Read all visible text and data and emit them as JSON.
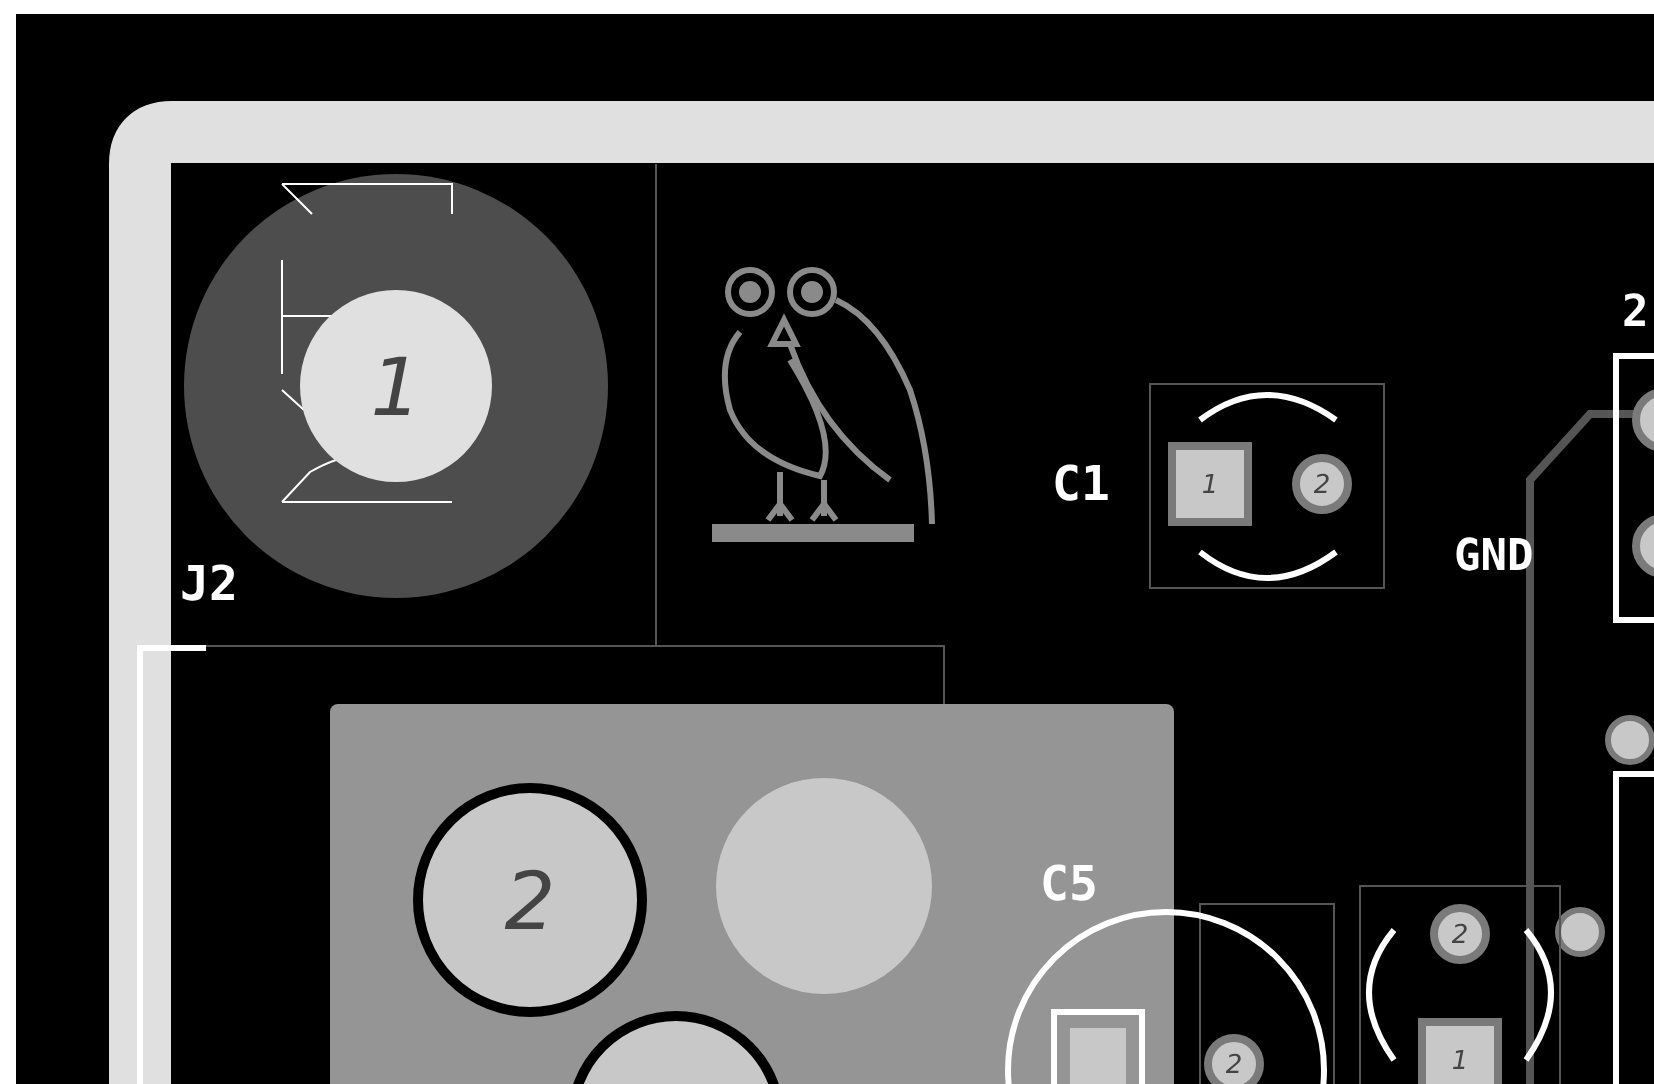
{
  "board": {
    "labels": [
      {
        "text": "J2"
      },
      {
        "text": "C1"
      },
      {
        "text": "GND"
      },
      {
        "text": "C5"
      },
      {
        "text": "2"
      }
    ],
    "pads": [
      {
        "number": "1",
        "kind": "round"
      },
      {
        "number": "2",
        "kind": "round"
      },
      {
        "number": "1",
        "kind": "square"
      },
      {
        "number": "2",
        "kind": "round"
      },
      {
        "number": "2",
        "kind": "round"
      },
      {
        "number": "2",
        "kind": "round"
      },
      {
        "number": "1",
        "kind": "square"
      }
    ]
  }
}
